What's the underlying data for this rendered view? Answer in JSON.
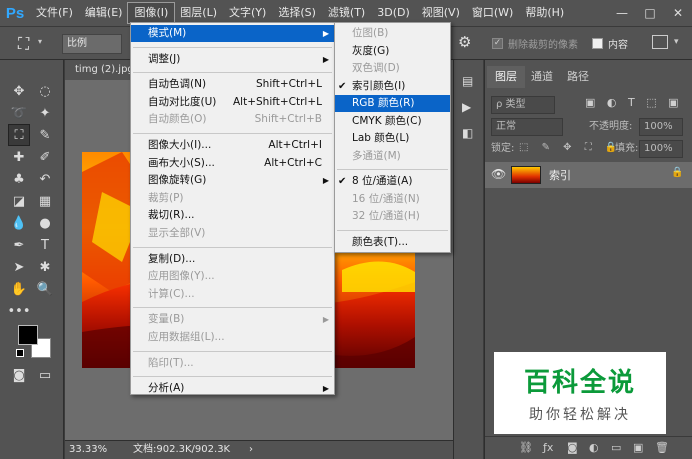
{
  "app": {
    "logo": "Ps"
  },
  "menubar": {
    "items": [
      "文件(F)",
      "编辑(E)",
      "图像(I)",
      "图层(L)",
      "文字(Y)",
      "选择(S)",
      "滤镜(T)",
      "3D(D)",
      "视图(V)",
      "窗口(W)",
      "帮助(H)"
    ],
    "active_index": 2
  },
  "window_controls": {
    "minimize": "—",
    "maximize": "□",
    "close": "✕"
  },
  "options_bar": {
    "crop_tool_icon": "crop-icon",
    "ratio_label": "比例",
    "delete_cropped_label": "删除裁剪的像素",
    "content_aware_label": "内容"
  },
  "document": {
    "tab_title": "timg (2).jpg",
    "zoom": "33.33%",
    "doc_size": "文档:902.3K/902.3K"
  },
  "image_menu": {
    "items": [
      {
        "label": "模式(M)",
        "submenu": true,
        "highlight": true
      },
      {
        "sep": true
      },
      {
        "label": "调整(J)",
        "submenu": true
      },
      {
        "sep": true
      },
      {
        "label": "自动色调(N)",
        "shortcut": "Shift+Ctrl+L"
      },
      {
        "label": "自动对比度(U)",
        "shortcut": "Alt+Shift+Ctrl+L"
      },
      {
        "label": "自动颜色(O)",
        "shortcut": "Shift+Ctrl+B",
        "disabled": true
      },
      {
        "sep": true
      },
      {
        "label": "图像大小(I)...",
        "shortcut": "Alt+Ctrl+I"
      },
      {
        "label": "画布大小(S)...",
        "shortcut": "Alt+Ctrl+C"
      },
      {
        "label": "图像旋转(G)",
        "submenu": true
      },
      {
        "label": "裁剪(P)",
        "disabled": true
      },
      {
        "label": "裁切(R)..."
      },
      {
        "label": "显示全部(V)",
        "disabled": true
      },
      {
        "sep": true
      },
      {
        "label": "复制(D)..."
      },
      {
        "label": "应用图像(Y)...",
        "disabled": true
      },
      {
        "label": "计算(C)...",
        "disabled": true
      },
      {
        "sep": true
      },
      {
        "label": "变量(B)",
        "submenu": true,
        "disabled": true
      },
      {
        "label": "应用数据组(L)...",
        "disabled": true
      },
      {
        "sep": true
      },
      {
        "label": "陷印(T)...",
        "disabled": true
      },
      {
        "sep": true
      },
      {
        "label": "分析(A)",
        "submenu": true
      }
    ]
  },
  "mode_submenu": {
    "items": [
      {
        "label": "位图(B)",
        "disabled": true
      },
      {
        "label": "灰度(G)"
      },
      {
        "label": "双色调(D)",
        "disabled": true
      },
      {
        "label": "索引颜色(I)",
        "checked": true
      },
      {
        "label": "RGB 颜色(R)",
        "highlight": true
      },
      {
        "label": "CMYK 颜色(C)"
      },
      {
        "label": "Lab 颜色(L)"
      },
      {
        "label": "多通道(M)",
        "disabled": true
      },
      {
        "sep": true
      },
      {
        "label": "8 位/通道(A)",
        "checked": true
      },
      {
        "label": "16 位/通道(N)",
        "disabled": true
      },
      {
        "label": "32 位/通道(H)",
        "disabled": true
      },
      {
        "sep": true
      },
      {
        "label": "颜色表(T)..."
      }
    ]
  },
  "layers_panel": {
    "tabs": [
      "图层",
      "通道",
      "路径"
    ],
    "active_tab": 0,
    "filter_label": "ρ 类型",
    "blend_mode": "正常",
    "opacity_label": "不透明度:",
    "opacity_value": "100%",
    "lock_label": "锁定:",
    "fill_label": "填充:",
    "fill_value": "100%",
    "layer_name": "索引"
  },
  "watermark": {
    "title": "百科全说",
    "subtitle": "助你轻松解决"
  },
  "colors": {
    "highlight": "#0a64c8",
    "ps_blue": "#31a8ff",
    "watermark_green": "#0b9a3a"
  }
}
